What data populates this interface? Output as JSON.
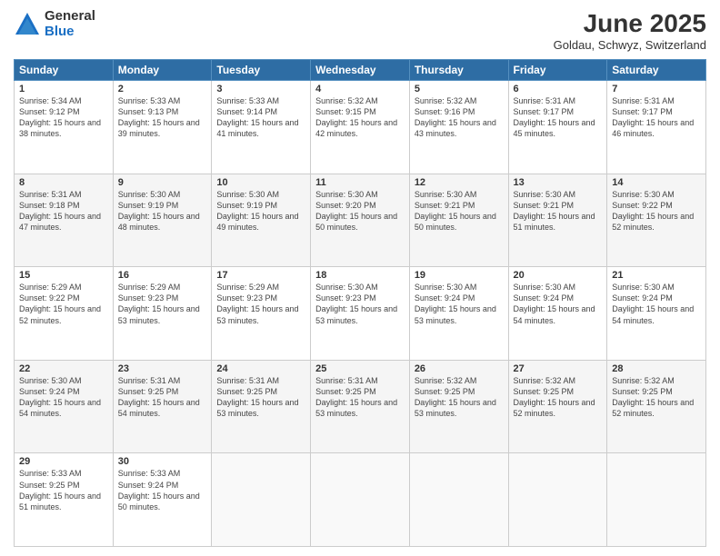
{
  "header": {
    "logo_general": "General",
    "logo_blue": "Blue",
    "title": "June 2025",
    "subtitle": "Goldau, Schwyz, Switzerland"
  },
  "days_of_week": [
    "Sunday",
    "Monday",
    "Tuesday",
    "Wednesday",
    "Thursday",
    "Friday",
    "Saturday"
  ],
  "weeks": [
    [
      {
        "day": 1,
        "sunrise": "5:34 AM",
        "sunset": "9:12 PM",
        "daylight": "15 hours and 38 minutes."
      },
      {
        "day": 2,
        "sunrise": "5:33 AM",
        "sunset": "9:13 PM",
        "daylight": "15 hours and 39 minutes."
      },
      {
        "day": 3,
        "sunrise": "5:33 AM",
        "sunset": "9:14 PM",
        "daylight": "15 hours and 41 minutes."
      },
      {
        "day": 4,
        "sunrise": "5:32 AM",
        "sunset": "9:15 PM",
        "daylight": "15 hours and 42 minutes."
      },
      {
        "day": 5,
        "sunrise": "5:32 AM",
        "sunset": "9:16 PM",
        "daylight": "15 hours and 43 minutes."
      },
      {
        "day": 6,
        "sunrise": "5:31 AM",
        "sunset": "9:17 PM",
        "daylight": "15 hours and 45 minutes."
      },
      {
        "day": 7,
        "sunrise": "5:31 AM",
        "sunset": "9:17 PM",
        "daylight": "15 hours and 46 minutes."
      }
    ],
    [
      {
        "day": 8,
        "sunrise": "5:31 AM",
        "sunset": "9:18 PM",
        "daylight": "15 hours and 47 minutes."
      },
      {
        "day": 9,
        "sunrise": "5:30 AM",
        "sunset": "9:19 PM",
        "daylight": "15 hours and 48 minutes."
      },
      {
        "day": 10,
        "sunrise": "5:30 AM",
        "sunset": "9:19 PM",
        "daylight": "15 hours and 49 minutes."
      },
      {
        "day": 11,
        "sunrise": "5:30 AM",
        "sunset": "9:20 PM",
        "daylight": "15 hours and 50 minutes."
      },
      {
        "day": 12,
        "sunrise": "5:30 AM",
        "sunset": "9:21 PM",
        "daylight": "15 hours and 50 minutes."
      },
      {
        "day": 13,
        "sunrise": "5:30 AM",
        "sunset": "9:21 PM",
        "daylight": "15 hours and 51 minutes."
      },
      {
        "day": 14,
        "sunrise": "5:30 AM",
        "sunset": "9:22 PM",
        "daylight": "15 hours and 52 minutes."
      }
    ],
    [
      {
        "day": 15,
        "sunrise": "5:29 AM",
        "sunset": "9:22 PM",
        "daylight": "15 hours and 52 minutes."
      },
      {
        "day": 16,
        "sunrise": "5:29 AM",
        "sunset": "9:23 PM",
        "daylight": "15 hours and 53 minutes."
      },
      {
        "day": 17,
        "sunrise": "5:29 AM",
        "sunset": "9:23 PM",
        "daylight": "15 hours and 53 minutes."
      },
      {
        "day": 18,
        "sunrise": "5:30 AM",
        "sunset": "9:23 PM",
        "daylight": "15 hours and 53 minutes."
      },
      {
        "day": 19,
        "sunrise": "5:30 AM",
        "sunset": "9:24 PM",
        "daylight": "15 hours and 53 minutes."
      },
      {
        "day": 20,
        "sunrise": "5:30 AM",
        "sunset": "9:24 PM",
        "daylight": "15 hours and 54 minutes."
      },
      {
        "day": 21,
        "sunrise": "5:30 AM",
        "sunset": "9:24 PM",
        "daylight": "15 hours and 54 minutes."
      }
    ],
    [
      {
        "day": 22,
        "sunrise": "5:30 AM",
        "sunset": "9:24 PM",
        "daylight": "15 hours and 54 minutes."
      },
      {
        "day": 23,
        "sunrise": "5:31 AM",
        "sunset": "9:25 PM",
        "daylight": "15 hours and 54 minutes."
      },
      {
        "day": 24,
        "sunrise": "5:31 AM",
        "sunset": "9:25 PM",
        "daylight": "15 hours and 53 minutes."
      },
      {
        "day": 25,
        "sunrise": "5:31 AM",
        "sunset": "9:25 PM",
        "daylight": "15 hours and 53 minutes."
      },
      {
        "day": 26,
        "sunrise": "5:32 AM",
        "sunset": "9:25 PM",
        "daylight": "15 hours and 53 minutes."
      },
      {
        "day": 27,
        "sunrise": "5:32 AM",
        "sunset": "9:25 PM",
        "daylight": "15 hours and 52 minutes."
      },
      {
        "day": 28,
        "sunrise": "5:32 AM",
        "sunset": "9:25 PM",
        "daylight": "15 hours and 52 minutes."
      }
    ],
    [
      {
        "day": 29,
        "sunrise": "5:33 AM",
        "sunset": "9:25 PM",
        "daylight": "15 hours and 51 minutes."
      },
      {
        "day": 30,
        "sunrise": "5:33 AM",
        "sunset": "9:24 PM",
        "daylight": "15 hours and 50 minutes."
      },
      null,
      null,
      null,
      null,
      null
    ]
  ]
}
